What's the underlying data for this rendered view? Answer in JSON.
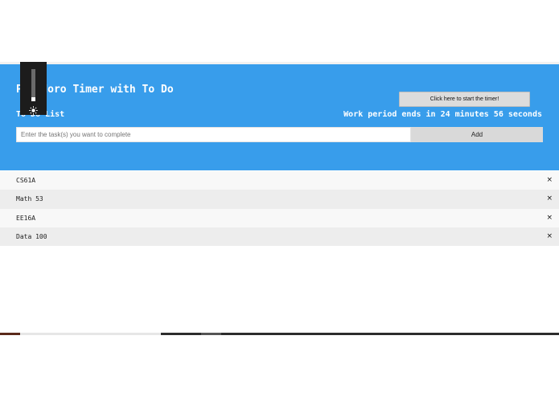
{
  "header": {
    "title": "Pomodoro Timer with To Do",
    "list_heading": "To Do List",
    "timer_status": "Work period ends in 24 minutes 56 seconds",
    "start_button_label": "Click here to start the timer!"
  },
  "task_input": {
    "value": "",
    "placeholder": "Enter the task(s) you want to complete"
  },
  "add_button_label": "Add",
  "brightness": {
    "level_percent": 12,
    "icon": "sun-icon"
  },
  "tasks": [
    {
      "name": "CS61A",
      "remove_label": "×"
    },
    {
      "name": "Math 53",
      "remove_label": "×"
    },
    {
      "name": "EE16A",
      "remove_label": "×"
    },
    {
      "name": "Data 100",
      "remove_label": "×"
    }
  ],
  "colors": {
    "header_bg": "#389deb",
    "row_odd": "#f8f8f8",
    "row_even": "#ededed"
  }
}
